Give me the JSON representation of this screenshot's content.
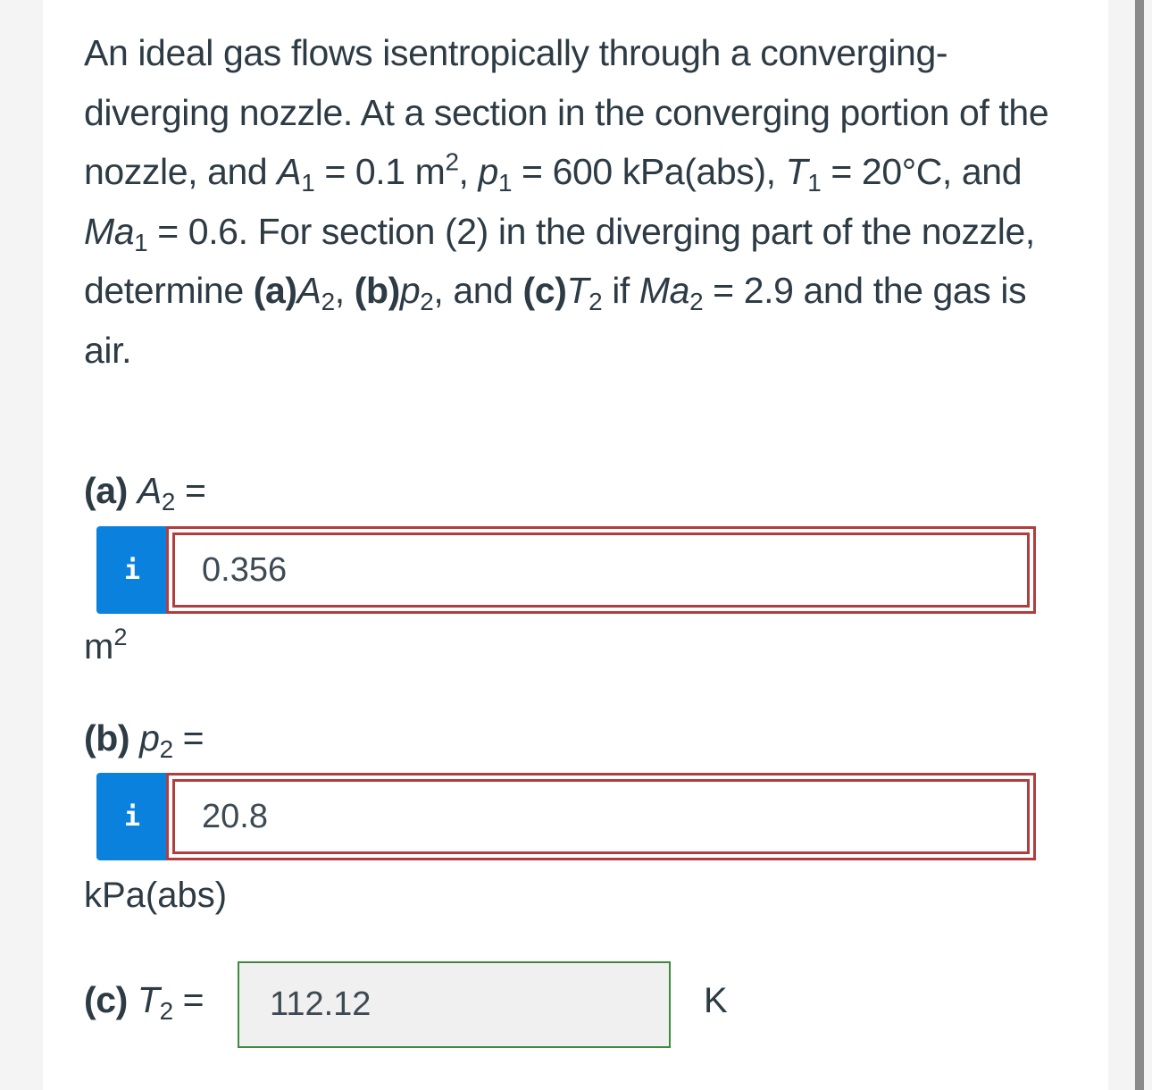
{
  "problem": {
    "intro": "An ideal gas flows isentropically through a converging-diverging nozzle. At a section in the converging portion of the nozzle, and ",
    "A1_sym": "A",
    "A1_sub": "1",
    "A1_val": " = 0.1 m",
    "A1_sup": "2",
    "sep1": ", ",
    "p1_sym": "p",
    "p1_sub": "1",
    "p1_val": " = 600 kPa(abs), ",
    "T1_sym": "T",
    "T1_sub": "1",
    "T1_val": " = 20°C, and ",
    "Ma1_sym": "Ma",
    "Ma1_sub": "1",
    "Ma1_val": " = 0.6. For section (2) in the diverging part of the nozzle, determine ",
    "a_tag": "(a)",
    "A2_sym": "A",
    "A2_sub": "2",
    "comma1": ", ",
    "b_tag": "(b)",
    "p2_sym": "p",
    "p2_sub": "2",
    "and1": ", and ",
    "c_tag": "(c)",
    "T2_sym": "T",
    "T2_sub": "2",
    "if_text": " if ",
    "Ma2_sym": "Ma",
    "Ma2_sub": "2",
    "tail": " = 2.9 and the gas is air."
  },
  "part_a": {
    "tag": "(a)",
    "sym": "A",
    "sub": "2",
    "eq": " =",
    "info_icon": "i",
    "value": "0.356",
    "unit_base": "m",
    "unit_sup": "2"
  },
  "part_b": {
    "tag": "(b)",
    "sym": "p",
    "sub": "2",
    "eq": " =",
    "info_icon": "i",
    "value": "20.8",
    "unit": "kPa(abs)"
  },
  "part_c": {
    "tag": "(c)",
    "sym": "T",
    "sub": "2",
    "eq": " =",
    "value": "112.12",
    "unit": "K"
  },
  "colors": {
    "incorrect_border": "#b33d3d",
    "correct_border": "#3d8b3d",
    "info_button": "#0a82dd",
    "text": "#2d3b45"
  }
}
